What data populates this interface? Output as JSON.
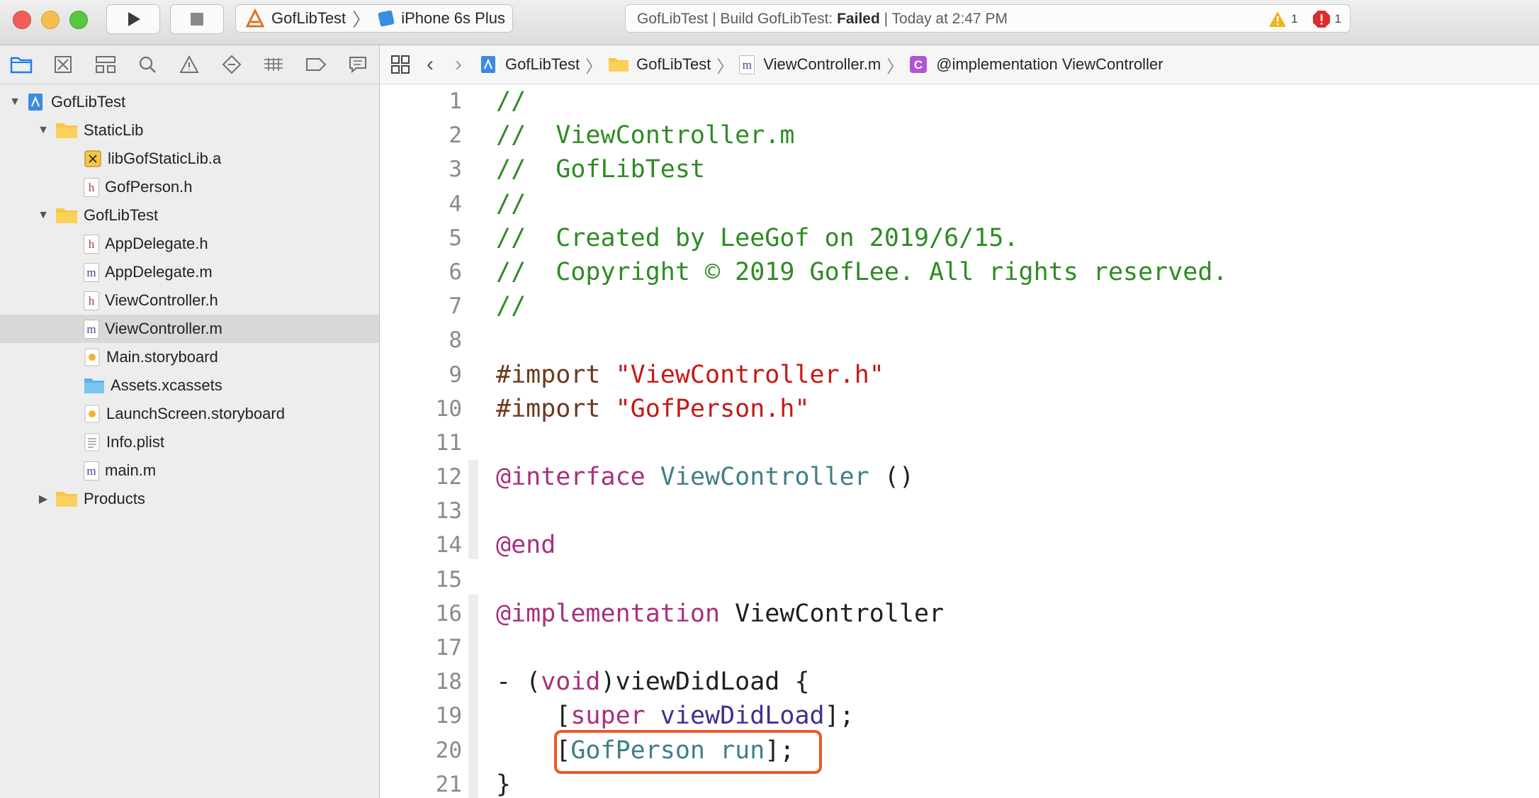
{
  "toolbar": {
    "scheme_project": "GofLibTest",
    "scheme_device": "iPhone 6s Plus",
    "status_prefix": "GofLibTest | Build GofLibTest: ",
    "status_result": "Failed",
    "status_suffix": " | Today at 2:47 PM",
    "warning_count": "1",
    "error_count": "1"
  },
  "navigator": {
    "tree": [
      {
        "label": "GofLibTest",
        "level": 0,
        "icon": "project-icon",
        "expanded": true
      },
      {
        "label": "StaticLib",
        "level": 1,
        "icon": "folder-icon",
        "expanded": true
      },
      {
        "label": "libGofStaticLib.a",
        "level": 2,
        "icon": "static-library-icon"
      },
      {
        "label": "GofPerson.h",
        "level": 2,
        "icon": "header-file-icon"
      },
      {
        "label": "GofLibTest",
        "level": 1,
        "icon": "folder-icon",
        "expanded": true
      },
      {
        "label": "AppDelegate.h",
        "level": 2,
        "icon": "header-file-icon"
      },
      {
        "label": "AppDelegate.m",
        "level": 2,
        "icon": "implementation-file-icon"
      },
      {
        "label": "ViewController.h",
        "level": 2,
        "icon": "header-file-icon"
      },
      {
        "label": "ViewController.m",
        "level": 2,
        "icon": "implementation-file-icon",
        "selected": true
      },
      {
        "label": "Main.storyboard",
        "level": 2,
        "icon": "storyboard-icon"
      },
      {
        "label": "Assets.xcassets",
        "level": 2,
        "icon": "asset-catalog-icon"
      },
      {
        "label": "LaunchScreen.storyboard",
        "level": 2,
        "icon": "storyboard-icon"
      },
      {
        "label": "Info.plist",
        "level": 2,
        "icon": "plist-icon"
      },
      {
        "label": "main.m",
        "level": 2,
        "icon": "implementation-file-icon"
      },
      {
        "label": "Products",
        "level": 1,
        "icon": "folder-icon",
        "expanded": false
      }
    ]
  },
  "jumpbar": {
    "crumbs": [
      "GofLibTest",
      "GofLibTest",
      "ViewController.m",
      "@implementation ViewController"
    ]
  },
  "editor": {
    "line_numbers": [
      "1",
      "2",
      "3",
      "4",
      "5",
      "6",
      "7",
      "8",
      "9",
      "10",
      "11",
      "12",
      "13",
      "14",
      "15",
      "16",
      "17",
      "18",
      "19",
      "20",
      "21"
    ],
    "lines": [
      [
        {
          "t": "//",
          "c": "comment"
        }
      ],
      [
        {
          "t": "//  ViewController.m",
          "c": "comment"
        }
      ],
      [
        {
          "t": "//  GofLibTest",
          "c": "comment"
        }
      ],
      [
        {
          "t": "//",
          "c": "comment"
        }
      ],
      [
        {
          "t": "//  Created by LeeGof on 2019/6/15.",
          "c": "comment"
        }
      ],
      [
        {
          "t": "//  Copyright © 2019 GofLee. All rights reserved.",
          "c": "comment"
        }
      ],
      [
        {
          "t": "//",
          "c": "comment"
        }
      ],
      [],
      [
        {
          "t": "#import ",
          "c": "pp"
        },
        {
          "t": "\"ViewController.h\"",
          "c": "str"
        }
      ],
      [
        {
          "t": "#import ",
          "c": "pp"
        },
        {
          "t": "\"GofPerson.h\"",
          "c": "str"
        }
      ],
      [],
      [
        {
          "t": "@interface",
          "c": "kw"
        },
        {
          "t": " ",
          "c": "plain"
        },
        {
          "t": "ViewController",
          "c": "cls"
        },
        {
          "t": " ()",
          "c": "plain"
        }
      ],
      [],
      [
        {
          "t": "@end",
          "c": "kw"
        }
      ],
      [],
      [
        {
          "t": "@implementation",
          "c": "kw"
        },
        {
          "t": " ViewController",
          "c": "plain"
        }
      ],
      [],
      [
        {
          "t": "- (",
          "c": "plain"
        },
        {
          "t": "void",
          "c": "kw"
        },
        {
          "t": ")viewDidLoad {",
          "c": "plain"
        }
      ],
      [
        {
          "t": "    [",
          "c": "plain"
        },
        {
          "t": "super",
          "c": "kw"
        },
        {
          "t": " ",
          "c": "plain"
        },
        {
          "t": "viewDidLoad",
          "c": "meth"
        },
        {
          "t": "];",
          "c": "plain"
        }
      ],
      [
        {
          "t": "    [",
          "c": "plain"
        },
        {
          "t": "GofPerson",
          "c": "cls"
        },
        {
          "t": " ",
          "c": "plain"
        },
        {
          "t": "run",
          "c": "cls"
        },
        {
          "t": "];",
          "c": "plain"
        }
      ],
      [
        {
          "t": "}",
          "c": "plain"
        }
      ]
    ]
  },
  "colors": {
    "comment": "#2e8b24",
    "preprocessor": "#6d3a1e",
    "string": "#c41a16",
    "keyword": "#a8307e",
    "class": "#3f7f87",
    "method": "#3f2f8f",
    "highlight": "#e85a2c"
  }
}
